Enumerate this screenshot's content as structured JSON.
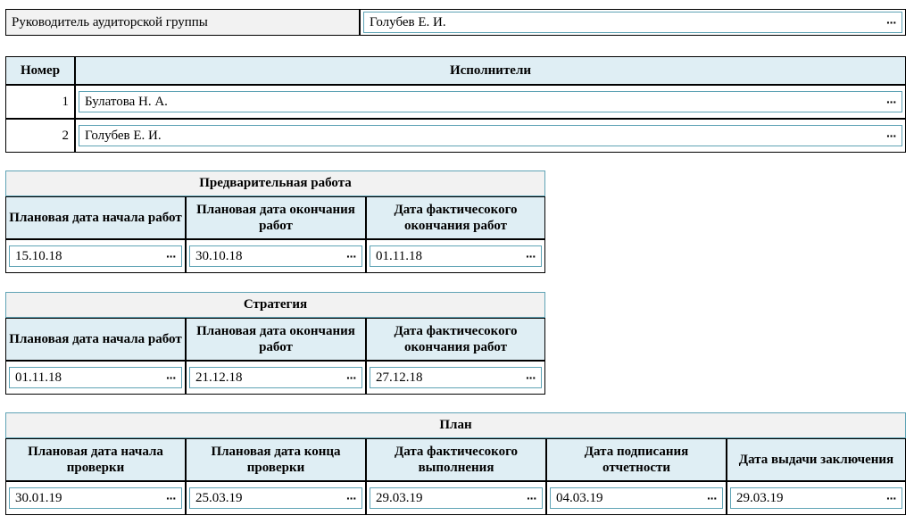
{
  "leader": {
    "label": "Руководитель аудиторской группы",
    "value": "Голубев Е. И."
  },
  "performers": {
    "col_number": "Номер",
    "col_performers": "Исполнители",
    "rows": [
      {
        "number": "1",
        "name": "Булатова Н. А."
      },
      {
        "number": "2",
        "name": "Голубев Е. И."
      }
    ]
  },
  "prelim": {
    "title": "Предварительная работа",
    "headers": [
      "Плановая дата начала работ",
      "Плановая дата окончания работ",
      "Дата фактичесокого окончания работ"
    ],
    "values": [
      "15.10.18",
      "30.10.18",
      "01.11.18"
    ]
  },
  "strategy": {
    "title": "Стратегия",
    "headers": [
      "Плановая дата начала работ",
      "Плановая дата окончания работ",
      "Дата фактичесокого окончания работ"
    ],
    "values": [
      "01.11.18",
      "21.12.18",
      "27.12.18"
    ]
  },
  "plan": {
    "title": "План",
    "headers": [
      "Плановая дата начала проверки",
      "Плановая дата конца проверки",
      "Дата фактичесокого выполнения",
      "Дата подписания отчетности",
      "Дата выдачи заключения"
    ],
    "values": [
      "30.01.19",
      "25.03.19",
      "29.03.19",
      "04.03.19",
      "29.03.19"
    ]
  },
  "ellipsis": "···"
}
